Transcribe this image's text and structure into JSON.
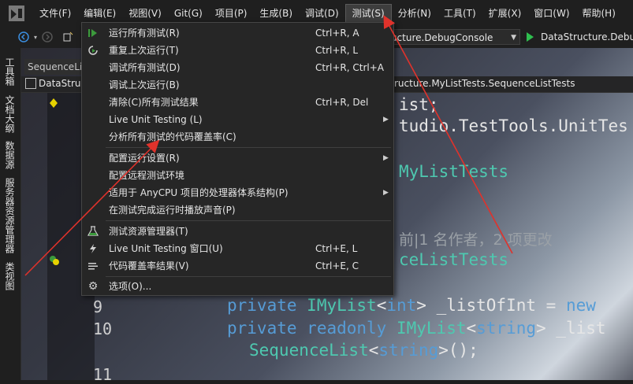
{
  "menubar": {
    "items": [
      "文件(F)",
      "编辑(E)",
      "视图(V)",
      "Git(G)",
      "项目(P)",
      "生成(B)",
      "调试(D)",
      "测试(S)",
      "分析(N)",
      "工具(T)",
      "扩展(X)",
      "窗口(W)",
      "帮助(H)"
    ],
    "active_index": 7
  },
  "toolbar": {
    "config_value": "ructure.DebugConsole",
    "run_label": "DataStructure.Debu"
  },
  "toolstrip": {
    "tabs": [
      "工具箱",
      "文档大纲",
      "数据源",
      "服务器资源管理器",
      "类视图"
    ]
  },
  "editor": {
    "doc_tab": "SequenceLis",
    "nav_left": "DataStru",
    "nav_right": "ructure.MyListTests.SequenceListTests",
    "code_fragments": {
      "l1": "ist;",
      "l2": "tudio.TestTools.UnitTes",
      "l3": "MyListTests",
      "lens": "前|1 名作者，2 项更改",
      "l4": "ceListTests",
      "ln9": "9",
      "ln10": "10",
      "ln11": "11",
      "c9_kw": "private",
      "c9_type": "IMyList",
      "c9_lt": "<",
      "c9_arg": "int",
      "c9_rest": "> _listOfInt = ",
      "c9_new": "new",
      "c10_kw": "private",
      "c10_kw2": "readonly",
      "c10_type": "IMyList",
      "c10_lt": "<",
      "c10_arg": "string",
      "c10_rest": "> _list",
      "c10b_type": "SequenceList",
      "c10b_lt": "<",
      "c10b_arg": "string",
      "c10b_rest": ">();"
    }
  },
  "test_menu": {
    "items": [
      {
        "label": "运行所有测试(R)",
        "shortcut": "Ctrl+R, A",
        "icon": "run-all-icon",
        "submenu": false
      },
      {
        "label": "重复上次运行(T)",
        "shortcut": "Ctrl+R, L",
        "icon": "repeat-run-icon",
        "submenu": false
      },
      {
        "label": "调试所有测试(D)",
        "shortcut": "Ctrl+R, Ctrl+A",
        "icon": "",
        "submenu": false
      },
      {
        "label": "调试上次运行(B)",
        "shortcut": "",
        "icon": "",
        "submenu": false
      },
      {
        "label": "清除(C)所有测试结果",
        "shortcut": "Ctrl+R, Del",
        "icon": "",
        "submenu": false
      },
      {
        "label": "Live Unit Testing (L)",
        "shortcut": "",
        "icon": "",
        "submenu": true
      },
      {
        "label": "分析所有测试的代码覆盖率(C)",
        "shortcut": "",
        "icon": "",
        "submenu": false
      },
      {
        "label": "配置运行设置(R)",
        "shortcut": "",
        "icon": "",
        "submenu": true
      },
      {
        "label": "配置远程测试环境",
        "shortcut": "",
        "icon": "",
        "submenu": false
      },
      {
        "label": "适用于 AnyCPU 项目的处理器体系结构(P)",
        "shortcut": "",
        "icon": "",
        "submenu": true
      },
      {
        "label": "在测试完成运行时播放声音(P)",
        "shortcut": "",
        "icon": "",
        "submenu": false
      },
      {
        "label": "测试资源管理器(T)",
        "shortcut": "",
        "icon": "test-explorer-icon",
        "submenu": false
      },
      {
        "label": "Live Unit Testing 窗口(U)",
        "shortcut": "Ctrl+E, L",
        "icon": "live-testing-icon",
        "submenu": false
      },
      {
        "label": "代码覆盖率结果(V)",
        "shortcut": "Ctrl+E, C",
        "icon": "coverage-results-icon",
        "submenu": false
      },
      {
        "label": "选项(O)...",
        "shortcut": "",
        "icon": "gear-icon",
        "submenu": false
      }
    ]
  },
  "colors": {
    "annotation": "#e0322b",
    "accent": "#3b8ee0",
    "run": "#2fbf4f"
  }
}
